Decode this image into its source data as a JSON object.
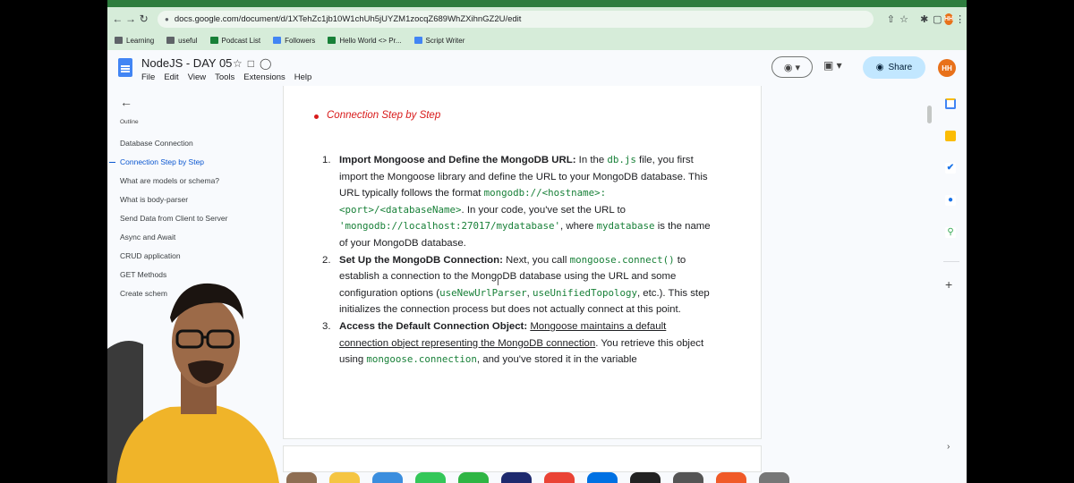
{
  "browser": {
    "url": "docs.google.com/document/d/1XTehZc1jb10W1chUh5jUYZM1zocqZ689WhZXihnGZ2U/edit",
    "avatar_initials": "HH",
    "bookmarks": [
      {
        "label": "Learning",
        "color": "#5f6368"
      },
      {
        "label": "useful",
        "color": "#5f6368"
      },
      {
        "label": "Podcast List",
        "color": "#188038"
      },
      {
        "label": "Followers",
        "color": "#4285f4"
      },
      {
        "label": "Hello World <> Pr...",
        "color": "#188038"
      },
      {
        "label": "Script Writer",
        "color": "#4285f4"
      }
    ]
  },
  "doc": {
    "title": "NodeJS - DAY 05",
    "menu": [
      "File",
      "Edit",
      "View",
      "Tools",
      "Extensions",
      "Help"
    ],
    "share_label": "Share",
    "user_initials": "HH"
  },
  "outline": {
    "label": "Outline",
    "items": [
      {
        "label": "Database Connection",
        "active": false
      },
      {
        "label": "Connection Step by Step",
        "active": true
      },
      {
        "label": "What are models or schema?",
        "active": false
      },
      {
        "label": "What is body-parser",
        "active": false
      },
      {
        "label": "Send Data from Client to Server",
        "active": false
      },
      {
        "label": "Async and Await",
        "active": false
      },
      {
        "label": "CRUD application",
        "active": false
      },
      {
        "label": "GET Methods",
        "active": false
      },
      {
        "label": "Create schem",
        "active": false
      }
    ]
  },
  "content": {
    "heading": "Connection Step by Step",
    "steps": [
      {
        "num": "1.",
        "title": "Import Mongoose and Define the MongoDB URL:",
        "t1": " In the ",
        "c1": "db.js",
        "t2": " file, you first import the Mongoose library and define the URL to your MongoDB database. This URL typically follows the format ",
        "c2": "mongodb://<hostname>:<port>/<databaseName>",
        "t3": ". In your code, you've set the URL to ",
        "c3": "'mongodb://localhost:27017/mydatabase'",
        "t4": ", where ",
        "c4": "mydatabase",
        "t5": " is the name of your MongoDB database."
      },
      {
        "num": "2.",
        "title": "Set Up the MongoDB Connection:",
        "t1": " Next, you call ",
        "c1": "mongoose.connect()",
        "t2": " to establish a connection to the MongoDB database using the URL and some configuration options (",
        "c2": "useNewUrlParser",
        "t3": ", ",
        "c3": "useUnifiedTopology",
        "t4": ", etc.). This step initializes the connection process but does not actually connect at this point."
      },
      {
        "num": "3.",
        "title": "Access the Default Connection Object:",
        "t1": " ",
        "u1": "Mongoose maintains a default connection object representing the MongoDB connection",
        "t2": ". You retrieve this object using ",
        "c1": "mongoose.connection",
        "t3": ", and you've stored it in the variable"
      }
    ]
  },
  "icons": {
    "back": "arrow-left-icon",
    "star": "star-icon",
    "folder": "folder-move-icon",
    "cloud": "cloud-status-icon",
    "eye": "view-mode-icon",
    "meet": "video-call-icon",
    "globe": "globe-icon"
  }
}
